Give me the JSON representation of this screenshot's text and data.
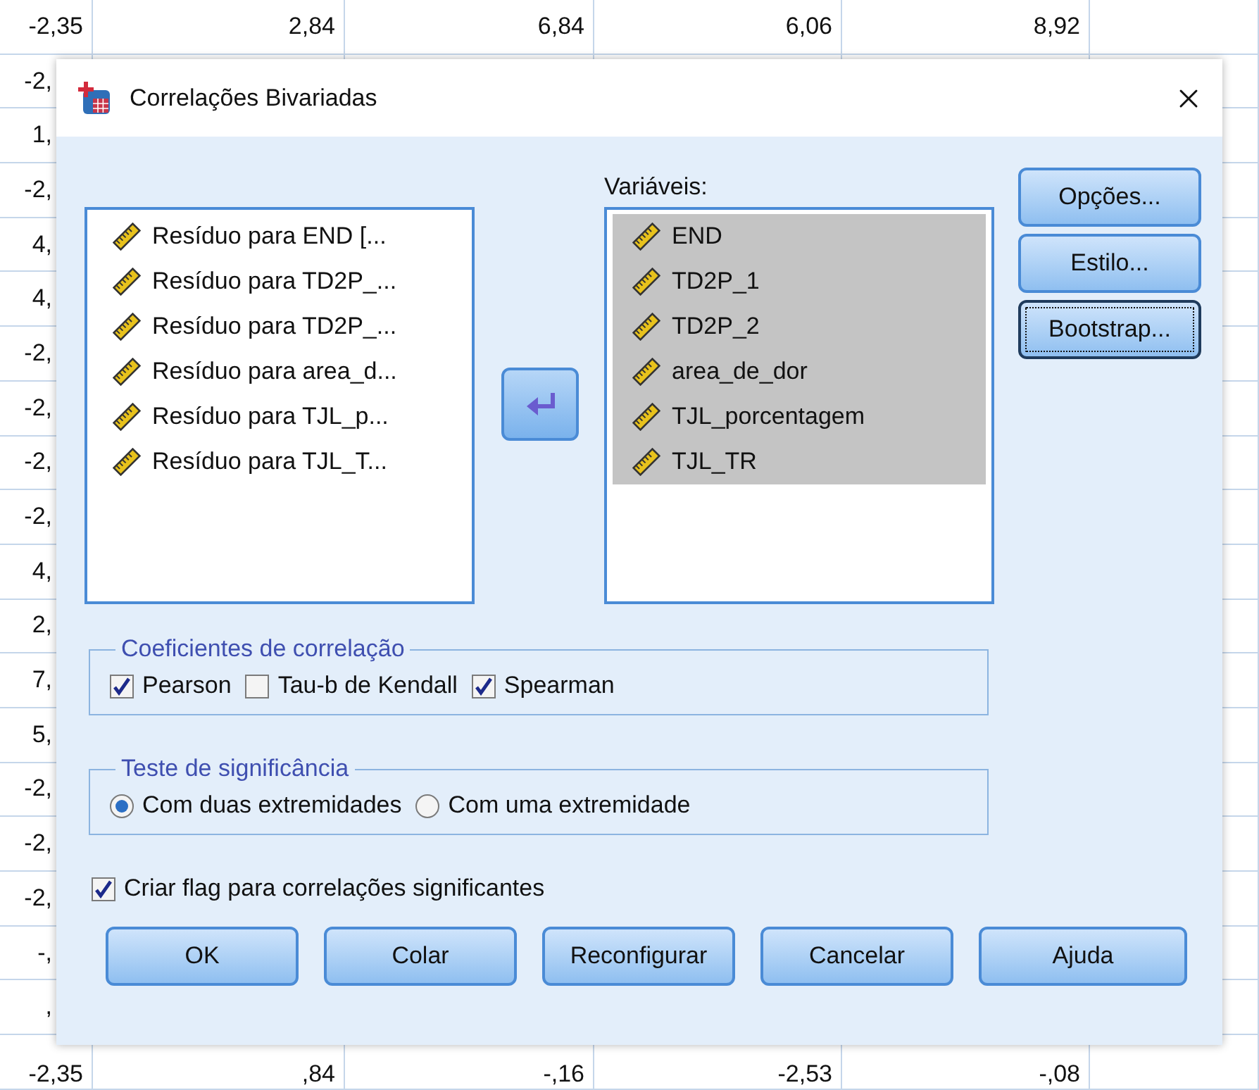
{
  "spreadsheet": {
    "rows": [
      [
        "-2,35",
        "2,84",
        "6,84",
        "6,06",
        "8,92"
      ],
      [
        "-2,"
      ],
      [
        "1,"
      ],
      [
        "-2,"
      ],
      [
        "4,"
      ],
      [
        "4,"
      ],
      [
        "-2,"
      ],
      [
        "-2,"
      ],
      [
        "-2,"
      ],
      [
        "-2,"
      ],
      [
        "4,"
      ],
      [
        "2,"
      ],
      [
        "7,"
      ],
      [
        "5,"
      ],
      [
        "-2,"
      ],
      [
        "-2,"
      ],
      [
        "-2,"
      ],
      [
        "-,"
      ],
      [
        ","
      ],
      [
        "-2,35",
        ",84",
        "-,16",
        "-2,53",
        "-,08"
      ]
    ]
  },
  "dialog": {
    "title": "Correlações Bivariadas",
    "source_list": {
      "items": [
        {
          "label": "Resíduo para END [...",
          "selected": false
        },
        {
          "label": "Resíduo para TD2P_...",
          "selected": false
        },
        {
          "label": "Resíduo para TD2P_...",
          "selected": false
        },
        {
          "label": "Resíduo para area_d...",
          "selected": false
        },
        {
          "label": "Resíduo para TJL_p...",
          "selected": false
        },
        {
          "label": "Resíduo para TJL_T...",
          "selected": false
        }
      ]
    },
    "variables": {
      "label": "Variáveis:",
      "items": [
        {
          "label": "END",
          "selected": true
        },
        {
          "label": "TD2P_1",
          "selected": true
        },
        {
          "label": "TD2P_2",
          "selected": true
        },
        {
          "label": "area_de_dor",
          "selected": true
        },
        {
          "label": "TJL_porcentagem",
          "selected": true
        },
        {
          "label": "TJL_TR",
          "selected": true
        }
      ]
    },
    "side_buttons": [
      {
        "label": "Opções...",
        "focused": false
      },
      {
        "label": "Estilo...",
        "focused": false
      },
      {
        "label": "Bootstrap...",
        "focused": true
      }
    ],
    "coefficients": {
      "title": "Coeficientes de correlação",
      "options": [
        {
          "label": "Pearson",
          "checked": true
        },
        {
          "label": "Tau-b de Kendall",
          "checked": false
        },
        {
          "label": "Spearman",
          "checked": true
        }
      ]
    },
    "significance": {
      "title": "Teste de significância",
      "options": [
        {
          "label": "Com duas extremidades",
          "selected": true
        },
        {
          "label": "Com uma extremidade",
          "selected": false
        }
      ]
    },
    "flag": {
      "label": "Criar flag para correlações significantes",
      "checked": true
    },
    "buttons": [
      {
        "label": "OK"
      },
      {
        "label": "Colar"
      },
      {
        "label": "Reconfigurar"
      },
      {
        "label": "Cancelar"
      },
      {
        "label": "Ajuda"
      }
    ]
  }
}
